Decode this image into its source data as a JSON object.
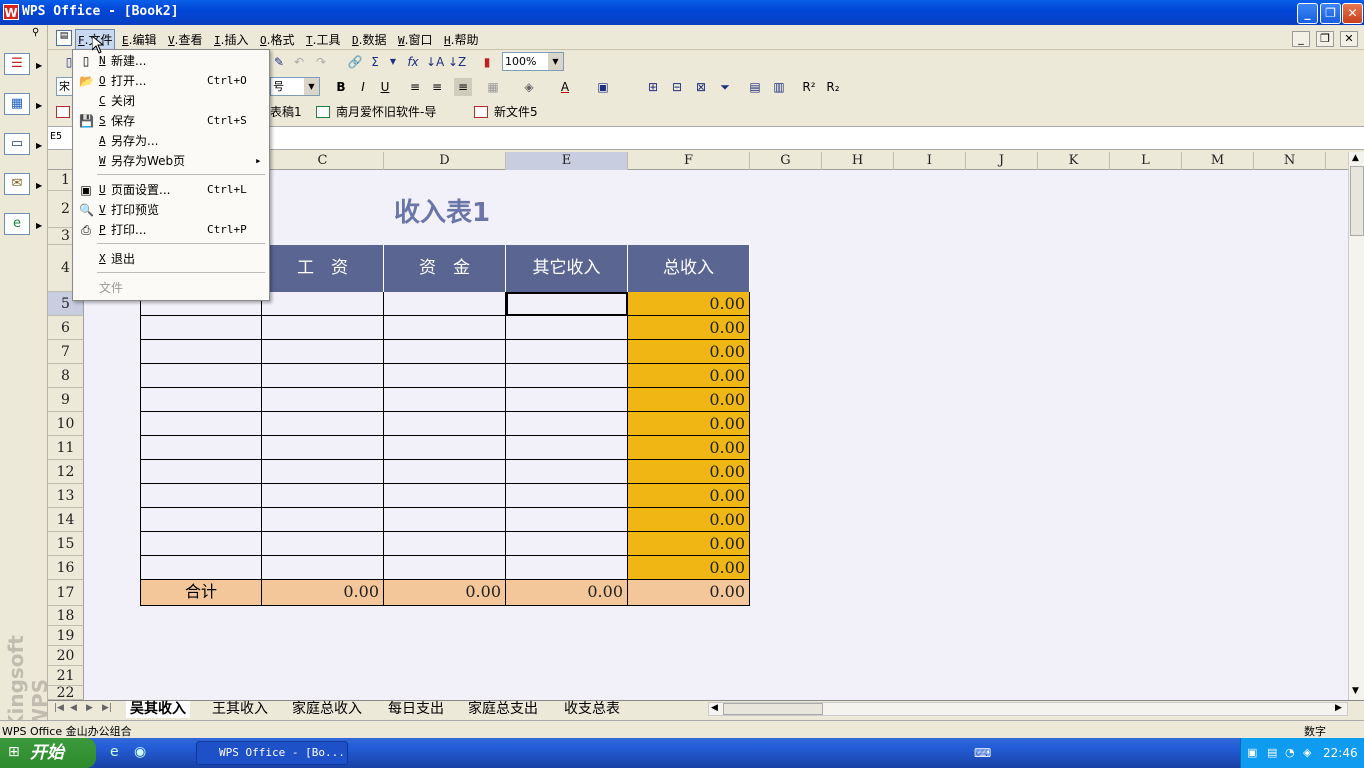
{
  "window": {
    "title": "WPS Office - [Book2]",
    "app_icon": "W"
  },
  "menubar": {
    "items": [
      {
        "acc": "F",
        "label": "文件"
      },
      {
        "acc": "E",
        "label": "编辑"
      },
      {
        "acc": "V",
        "label": "查看"
      },
      {
        "acc": "I",
        "label": "插入"
      },
      {
        "acc": "O",
        "label": "格式"
      },
      {
        "acc": "T",
        "label": "工具"
      },
      {
        "acc": "D",
        "label": "数据"
      },
      {
        "acc": "W",
        "label": "窗口"
      },
      {
        "acc": "H",
        "label": "帮助"
      }
    ]
  },
  "toolbar": {
    "zoom": "100%",
    "font_size": "号",
    "font_name": "宋"
  },
  "doctabs": [
    {
      "label": "表稿1"
    },
    {
      "label": "南月爱怀旧软件-导"
    },
    {
      "label": "新文件5"
    }
  ],
  "formula": {
    "namebox": "E5"
  },
  "sheet": {
    "columns": [
      "C",
      "D",
      "E",
      "F",
      "G",
      "H",
      "I",
      "J",
      "K",
      "L",
      "M",
      "N"
    ],
    "rows": [
      "1",
      "2",
      "3",
      "4",
      "5",
      "6",
      "7",
      "8",
      "9",
      "10",
      "11",
      "12",
      "13",
      "14",
      "15",
      "16",
      "17",
      "18",
      "19",
      "20",
      "21",
      "22"
    ],
    "title": "收入表1",
    "table_headers": [
      "工　资",
      "资　金",
      "其它收入",
      "总收入"
    ],
    "total_values": [
      "0.00",
      "0.00",
      "0.00",
      "0.00",
      "0.00",
      "0.00",
      "0.00",
      "0.00",
      "0.00",
      "0.00",
      "0.00",
      "0.00"
    ],
    "sum_label": "合计",
    "sum_values": [
      "0.00",
      "0.00",
      "0.00",
      "0.00"
    ]
  },
  "sheet_tabs": [
    "吴其收入",
    "王其收入",
    "家庭总收入",
    "每日支出",
    "家庭总支出",
    "收支总表"
  ],
  "status": {
    "left": "WPS Office 金山办公组合",
    "right": "数字"
  },
  "taskbar": {
    "start": "开始",
    "task": "WPS Office - [Bo...",
    "clock": "22:46"
  },
  "file_menu": {
    "items": [
      {
        "acc": "N",
        "label": "新建...",
        "shortcut": "",
        "icon": "new-doc-icon"
      },
      {
        "acc": "O",
        "label": "打开...",
        "shortcut": "Ctrl+O",
        "icon": "open-folder-icon"
      },
      {
        "acc": "C",
        "label": "关闭",
        "shortcut": "",
        "icon": ""
      },
      {
        "acc": "S",
        "label": "保存",
        "shortcut": "Ctrl+S",
        "icon": "save-icon"
      },
      {
        "acc": "A",
        "label": "另存为...",
        "shortcut": "",
        "icon": ""
      },
      {
        "acc": "W",
        "label": "另存为Web页",
        "shortcut": "▸",
        "icon": ""
      },
      {
        "acc": "U",
        "label": "页面设置...",
        "shortcut": "Ctrl+L",
        "icon": "page-setup-icon"
      },
      {
        "acc": "V",
        "label": "打印预览",
        "shortcut": "",
        "icon": "print-preview-icon"
      },
      {
        "acc": "P",
        "label": "打印...",
        "shortcut": "Ctrl+P",
        "icon": "print-icon"
      },
      {
        "acc": "X",
        "label": "退出",
        "shortcut": "",
        "icon": ""
      }
    ],
    "footer": "文件"
  }
}
